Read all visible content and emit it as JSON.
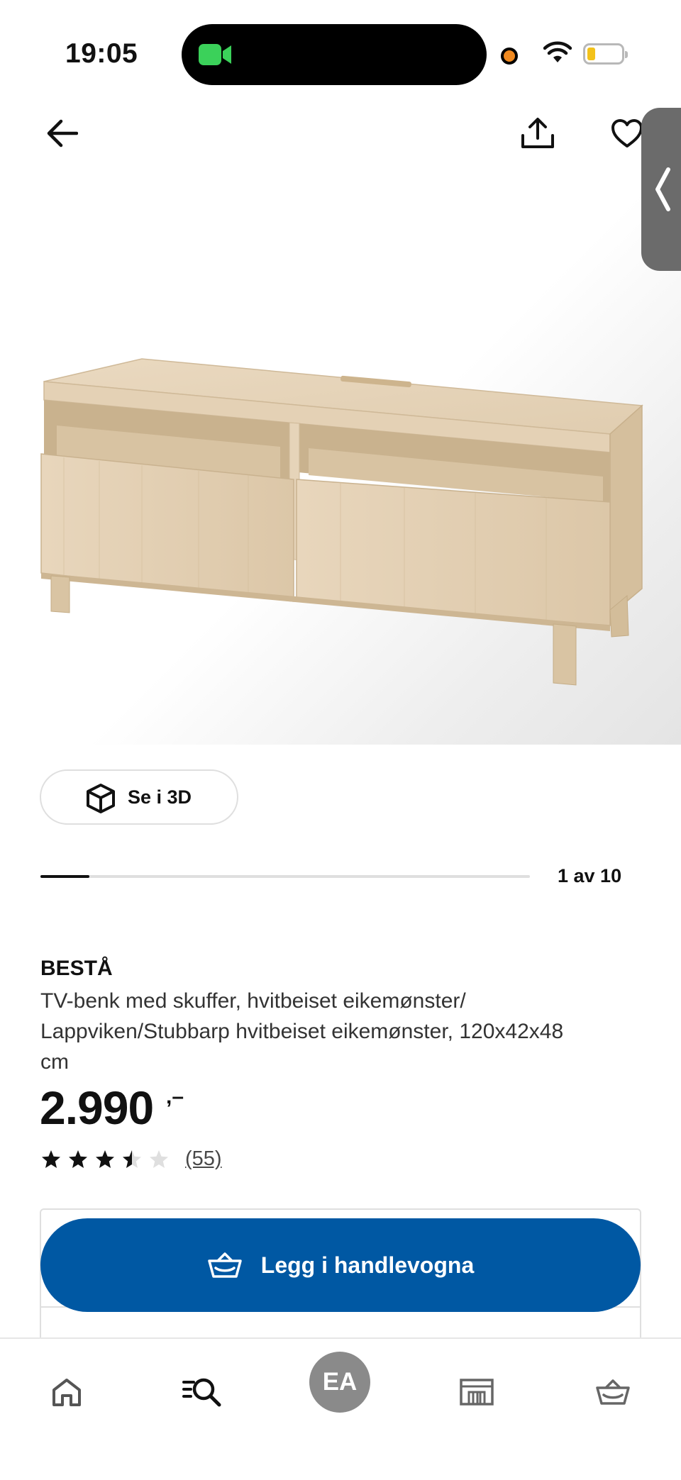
{
  "status_bar": {
    "time": "19:05"
  },
  "actions": {
    "view_3d_label": "Se i 3D",
    "add_to_cart_label": "Legg i handlevogna"
  },
  "carousel": {
    "counter": "1 av 10",
    "current": 1,
    "total": 10
  },
  "product": {
    "brand": "BESTÅ",
    "description": "TV-benk med skuffer, hvitbeiset eikemønster/ Lappviken/Stubbarp hvitbeiset eikemønster, 120x42x48 cm",
    "price": "2.990",
    "price_suffix": ",–",
    "rating": {
      "stars": 3.5,
      "max": 5,
      "count": "(55)"
    }
  },
  "bottom_nav": {
    "avatar_initials": "EA"
  },
  "icons": [
    "back-arrow-icon",
    "share-icon",
    "heart-icon",
    "chevron-left-icon",
    "cube-3d-icon",
    "cart-icon",
    "home-icon",
    "search-icon",
    "store-icon",
    "basket-icon"
  ],
  "colors": {
    "primary": "#0058a3",
    "avatar": "#8a8a8a",
    "star": "#111111",
    "star_empty": "#dfdfdf"
  }
}
